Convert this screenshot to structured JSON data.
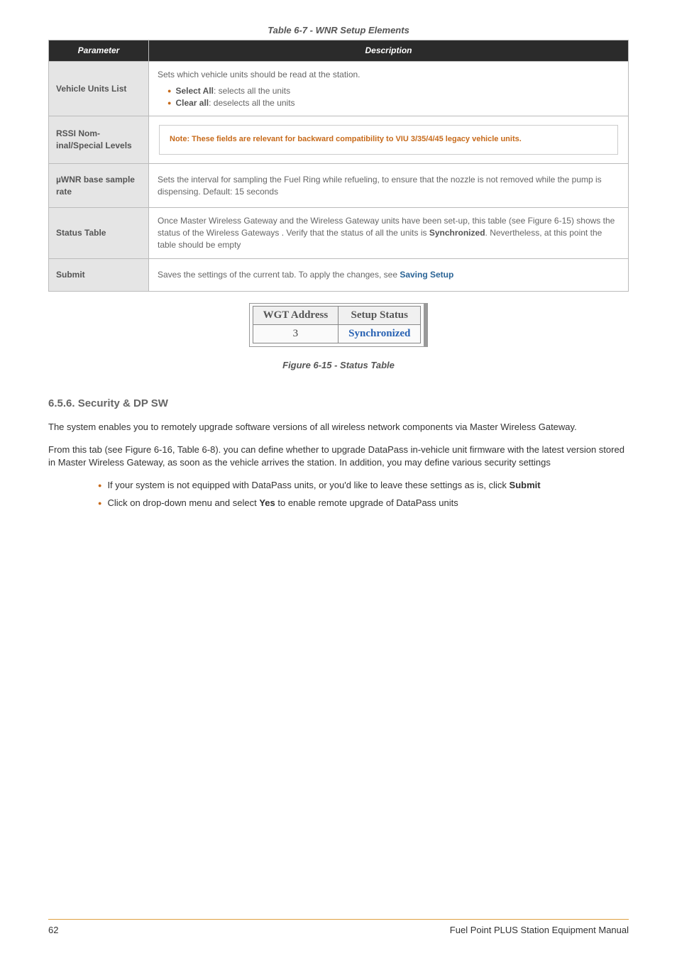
{
  "table": {
    "title": "Table 6-7 - WNR Setup Elements",
    "headers": {
      "parameter": "Parameter",
      "description": "Description"
    },
    "rows": {
      "r0": {
        "param": "Vehicle Units List",
        "lead": "Sets which vehicle units should be read at the station.",
        "li0_b": "Select All",
        "li0_t": ": selects all the units",
        "li1_b": "Clear all",
        "li1_t": ": deselects all the units"
      },
      "r1": {
        "param": "RSSI Nom­inal/Special Levels",
        "note": "Note: These fields are relevant for backward compatibility to VIU 3/35/4/45 legacy vehicle units."
      },
      "r2": {
        "param": "µWNR base sample rate",
        "text": "Sets the interval for sampling the Fuel Ring while refueling, to ensure that the nozzle is not removed while the pump is dispensing. Default: 15 seconds"
      },
      "r3": {
        "param": "Status Table",
        "t0": "Once Master Wireless Gateway and the Wireless Gateway units have been set-up, this table (see Figure 6-15) shows the status of the Wireless Gateways . Verify that the status of all the units is ",
        "b0": "Synchronized",
        "t1": ". Nevertheless, at this point the table should be empty"
      },
      "r4": {
        "param": "Submit",
        "t0": "Saves the settings of the current tab. To apply the changes, see ",
        "link": "Saving Setup"
      }
    }
  },
  "status_table": {
    "headers": {
      "addr": "WGT Address",
      "status": "Setup Status"
    },
    "row": {
      "addr": "3",
      "status": "Synchronized"
    },
    "caption": "Figure 6-15 - Status Table"
  },
  "section": {
    "heading": "6.5.6. Security & DP SW",
    "p1": "The system enables you to remotely upgrade software versions of all wireless network components via Master Wireless Gateway.",
    "p2": "From this tab  (see Figure 6-16, Table 6-8). you can define whether to upgrade DataPass in-vehicle unit firmware with the latest version stored in Master Wireless Gateway, as soon as the vehicle arrives the station. In addition, you may define various security settings",
    "li0_a": "If your system is not equipped with DataPass units, or you'd like to leave these settings as is, click ",
    "li0_b": "Submit",
    "li1_a": "Click on drop-down menu and select ",
    "li1_b": "Yes",
    "li1_c": " to enable remote upgrade of DataPass units"
  },
  "footer": {
    "page": "62",
    "title": "Fuel Point PLUS Station Equipment Manual"
  }
}
